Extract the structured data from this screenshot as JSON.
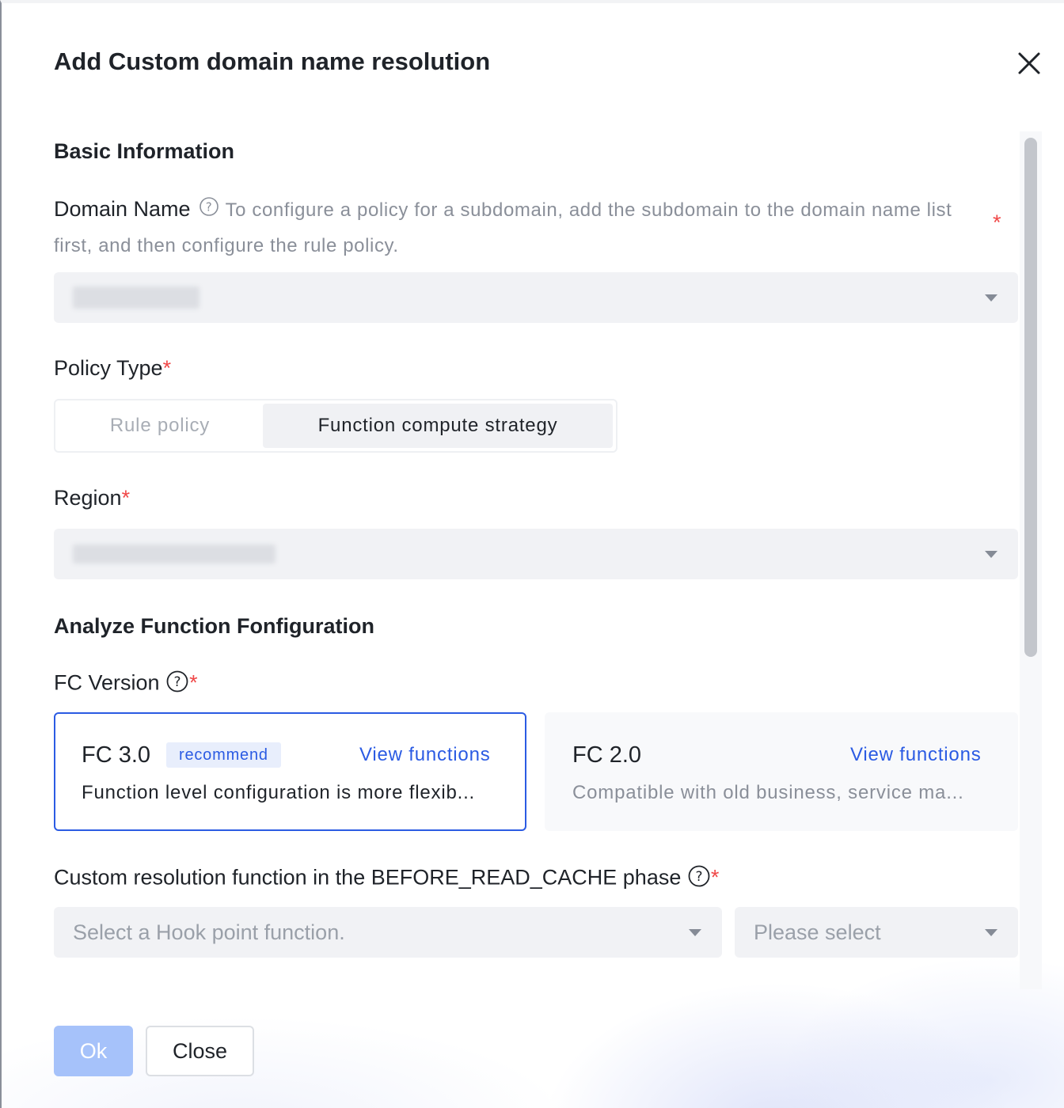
{
  "dialog": {
    "title": "Add Custom domain name resolution",
    "close_icon": "close-icon"
  },
  "basic_info": {
    "section_title": "Basic Information",
    "domain_name": {
      "label": "Domain Name",
      "tip": "To configure a policy for a subdomain, add the subdomain to the domain name list first, and then configure the rule policy.",
      "required_mark": "*",
      "value": "",
      "value_redacted": true
    },
    "policy_type": {
      "label": "Policy Type",
      "required_mark": "*",
      "options": [
        "Rule policy",
        "Function compute strategy"
      ],
      "selected": "Function compute strategy"
    },
    "region": {
      "label": "Region",
      "required_mark": "*",
      "value": "",
      "value_redacted": true
    }
  },
  "analyze": {
    "section_title": "Analyze Function Fonfiguration",
    "fc_version": {
      "label": "FC Version",
      "required_mark": "*",
      "cards": [
        {
          "title": "FC 3.0",
          "tag": "recommend",
          "link": "View functions",
          "description": "Function level configuration is more flexib...",
          "selected": true
        },
        {
          "title": "FC 2.0",
          "link": "View functions",
          "description": "Compatible with old business, service ma...",
          "selected": false
        }
      ]
    },
    "hook": {
      "label": "Custom resolution function in the BEFORE_READ_CACHE phase",
      "required_mark": "*",
      "function_placeholder": "Select a Hook point function.",
      "version_placeholder": "Please select"
    }
  },
  "footer": {
    "ok_label": "Ok",
    "close_label": "Close"
  },
  "colors": {
    "primary": "#2b5be3",
    "primary_disabled": "#a6c2fa",
    "required": "#f04848",
    "input_bg": "#f1f2f5"
  }
}
